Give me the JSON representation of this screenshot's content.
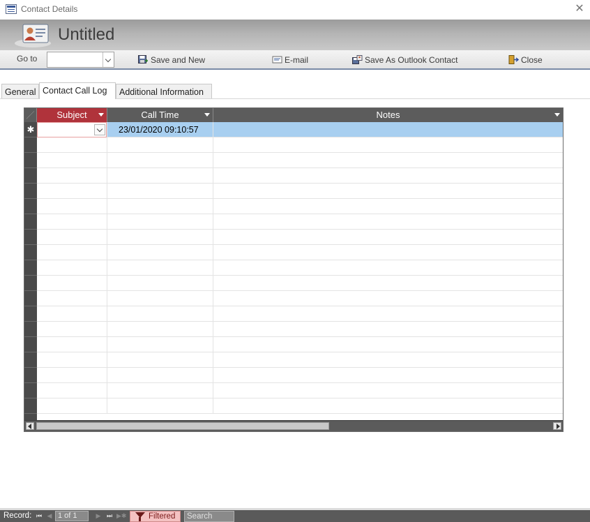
{
  "window": {
    "title": "Contact Details"
  },
  "header": {
    "form_title": "Untitled"
  },
  "toolbar": {
    "goto_label": "Go to",
    "goto_value": "",
    "save_and_new_label": "Save and New",
    "email_label": "E-mail",
    "save_outlook_label": "Save As Outlook Contact",
    "close_label": "Close"
  },
  "tabs": [
    {
      "label": "General"
    },
    {
      "label": "Contact Call Log",
      "active": true
    },
    {
      "label": "Additional Information"
    }
  ],
  "datasheet": {
    "columns": [
      "Subject",
      "Call Time",
      "Notes"
    ],
    "active_column": "Subject",
    "new_row": {
      "subject": "",
      "call_time": "23/01/2020 09:10:57",
      "notes": ""
    },
    "new_row_marker": "✱"
  },
  "navigation": {
    "record_label": "Record:",
    "position": "1 of 1",
    "filter_label": "Filtered",
    "search_placeholder": "Search"
  },
  "colors": {
    "active_header": "#b0333b",
    "header": "#5c5c5c",
    "selected_row": "#a8cff0",
    "filter_badge": "#f4c2c2"
  }
}
